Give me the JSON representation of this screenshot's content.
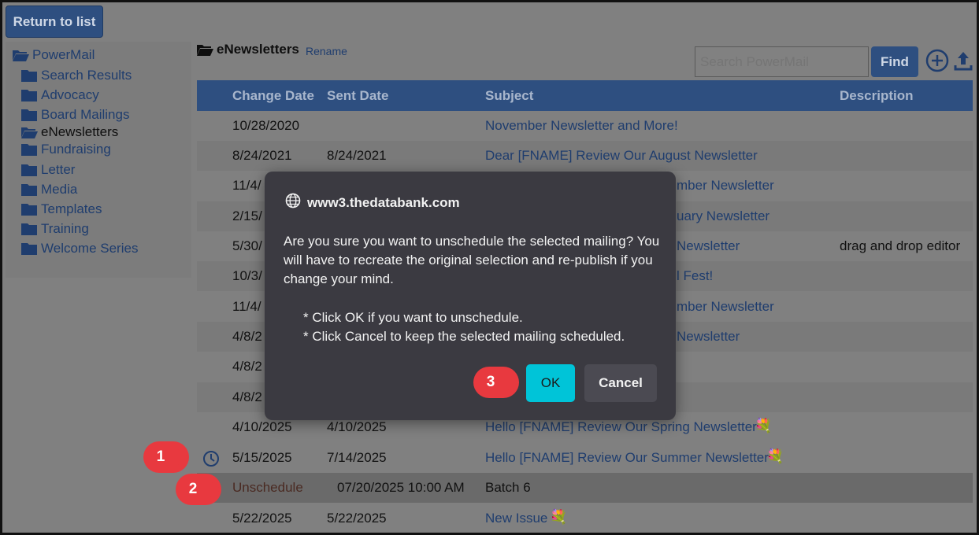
{
  "toolbar": {
    "return_label": "Return to list",
    "search_placeholder": "Search PowerMail",
    "find_label": "Find"
  },
  "sidebar": {
    "root": "PowerMail",
    "items": [
      {
        "label": "Search Results"
      },
      {
        "label": "Advocacy"
      },
      {
        "label": "Board Mailings"
      },
      {
        "label": "eNewsletters"
      },
      {
        "label": "Fundraising"
      },
      {
        "label": "Letter"
      },
      {
        "label": "Media"
      },
      {
        "label": "Templates"
      },
      {
        "label": "Training"
      },
      {
        "label": "Welcome Series"
      }
    ]
  },
  "content": {
    "folder_title": "eNewsletters",
    "rename_label": "Rename"
  },
  "table": {
    "headers": {
      "change_date": "Change Date",
      "sent_date": "Sent Date",
      "subject": "Subject",
      "description": "Description"
    },
    "rows": [
      {
        "change": "10/28/2020",
        "sent": "",
        "subject": "November Newsletter and More!",
        "desc": ""
      },
      {
        "change": "8/24/2021",
        "sent": "8/24/2021",
        "subject": "Dear [FNAME] Review Our August Newsletter",
        "desc": ""
      },
      {
        "change": "11/4/",
        "sent": "",
        "subject": "mber Newsletter",
        "desc": ""
      },
      {
        "change": "2/15/",
        "sent": "",
        "subject": "uary Newsletter",
        "desc": ""
      },
      {
        "change": "5/30/",
        "sent": "",
        "subject": "Newsletter",
        "desc": "drag and drop editor"
      },
      {
        "change": "10/3/",
        "sent": "",
        "subject": "l Fest!",
        "desc": ""
      },
      {
        "change": "11/4/",
        "sent": "",
        "subject": "mber Newsletter",
        "desc": ""
      },
      {
        "change": "4/8/2",
        "sent": "",
        "subject": "Newsletter",
        "desc": ""
      },
      {
        "change": "4/8/2",
        "sent": "",
        "subject": "",
        "desc": ""
      },
      {
        "change": "4/8/2",
        "sent": "",
        "subject": "",
        "desc": ""
      },
      {
        "change": "4/10/2025",
        "sent": "4/10/2025",
        "subject": "Hello [FNAME] Review Our Spring Newsletter",
        "desc": ""
      },
      {
        "change": "5/15/2025",
        "sent": "7/14/2025",
        "subject": "Hello [FNAME] Review Our Summer Newsletter",
        "desc": ""
      },
      {
        "change": "Unschedule",
        "sent": "07/20/2025 10:00 AM",
        "subject": "Batch 6",
        "desc": ""
      },
      {
        "change": "5/22/2025",
        "sent": "5/22/2025",
        "subject": "New Issue",
        "desc": ""
      }
    ]
  },
  "dialog": {
    "origin": "www3.thedatabank.com",
    "message": "Are you sure you want to unschedule the selected mailing? You will have to recreate the original selection and re-publish if you change your mind.",
    "bullet_1": "* Click OK if you want to unschedule.",
    "bullet_2": "* Click Cancel to keep the selected mailing scheduled.",
    "ok_label": "OK",
    "cancel_label": "Cancel"
  },
  "steps": {
    "step1": "1",
    "step2": "2",
    "step3": "3"
  },
  "colors": {
    "accent": "#2e4f80",
    "link": "#1f3d6e",
    "ok_button": "#00c4d8",
    "dialog_bg": "#3b3a41",
    "badge": "#e8393f"
  },
  "icons": {
    "add": "plus-circle-icon",
    "upload": "upload-icon",
    "clock": "clock-icon",
    "globe": "globe-icon",
    "folder": "folder-icon",
    "flower": "flower-icon"
  }
}
